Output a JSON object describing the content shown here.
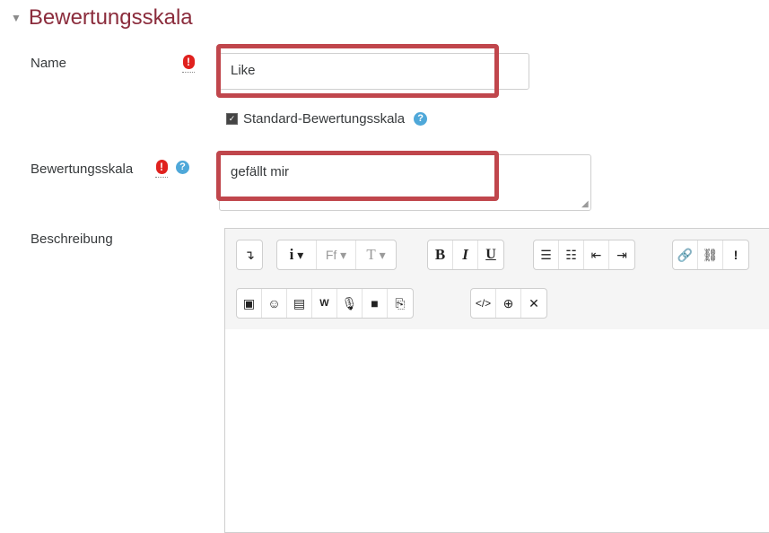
{
  "section": {
    "title": "Bewertungsskala",
    "caret_icon": "caret-down-icon"
  },
  "fields": {
    "name": {
      "label": "Name",
      "value": "Like",
      "required_icon": "exclamation-icon"
    },
    "standard": {
      "label": "Standard-Bewertungsskala",
      "checked": true,
      "help_icon": "question-icon"
    },
    "scale": {
      "label": "Bewertungsskala",
      "value": "gefällt mir",
      "required_icon": "exclamation-icon",
      "help_icon": "question-icon"
    },
    "description": {
      "label": "Beschreibung",
      "value": ""
    }
  },
  "toolbar": {
    "row1": [
      [
        "toggle-toolbar"
      ],
      [
        "info-menu",
        "font-family-menu",
        "font-size-menu"
      ],
      [
        "bold",
        "italic",
        "underline"
      ],
      [
        "bulleted-list",
        "numbered-list",
        "outdent",
        "indent"
      ],
      [
        "link",
        "unlink",
        "more"
      ]
    ],
    "row2": [
      [
        "image",
        "emoji",
        "media",
        "word-import",
        "record-audio",
        "record-video",
        "paste"
      ],
      [
        "html-source",
        "zoom",
        "fullscreen"
      ]
    ],
    "labels": {
      "bold": "B",
      "italic": "I",
      "underline": "U",
      "info": "i",
      "font_family": "Ff",
      "font_size": "T",
      "more": "!"
    }
  },
  "colors": {
    "accent": "#8b2c3c",
    "highlight": "#c0464c",
    "required": "#e0211e",
    "help": "#4fa8d9"
  }
}
